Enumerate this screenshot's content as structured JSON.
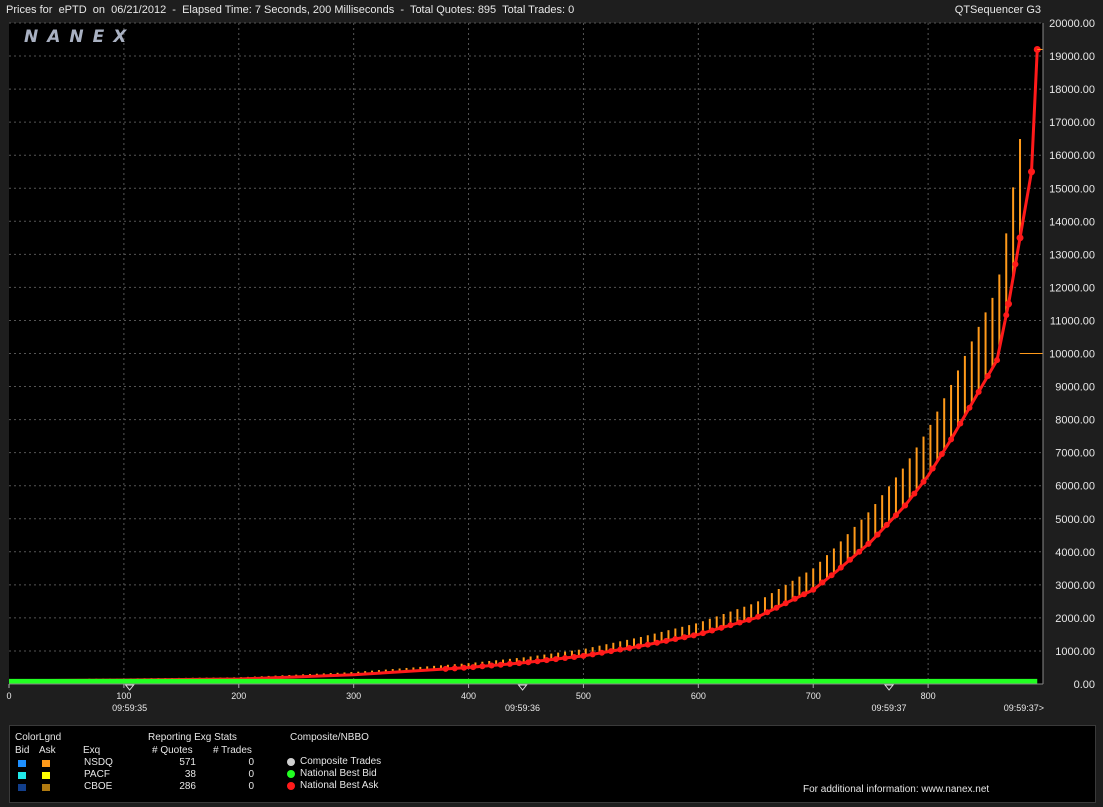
{
  "header": {
    "title": "Prices for  ePTD  on  06/21/2012  -  Elapsed Time: 7 Seconds, 200 Milliseconds  -  Total Quotes: 895  Total Trades: 0",
    "app_name": "QTSequencer G3"
  },
  "watermark": "NANEX",
  "colors": {
    "background": "#000000",
    "grid": "#555555",
    "nsdq_ask": "#ff9a1a",
    "national_best_ask": "#ff1a1a",
    "national_best_bid": "#22ff22",
    "composite_trades": "#d0d0d0"
  },
  "chart_data": {
    "type": "line",
    "title": "",
    "xlabel": "",
    "ylabel": "",
    "xlim": [
      0,
      900
    ],
    "ylim": [
      0,
      20000
    ],
    "grid": true,
    "x_ticks": [
      0,
      100,
      200,
      300,
      400,
      500,
      600,
      700,
      800
    ],
    "y_ticks": [
      "0.00",
      "1000.00",
      "2000.00",
      "3000.00",
      "4000.00",
      "5000.00",
      "6000.00",
      "7000.00",
      "8000.00",
      "9000.00",
      "10000.00",
      "11000.00",
      "12000.00",
      "13000.00",
      "14000.00",
      "15000.00",
      "16000.00",
      "17000.00",
      "18000.00",
      "19000.00",
      "20000.00"
    ],
    "time_labels": [
      {
        "x": 105,
        "label": "09:59:35"
      },
      {
        "x": 447,
        "label": "09:59:36"
      },
      {
        "x": 766,
        "label": "09:59:37"
      },
      {
        "x": 900,
        "label": "09:59:37>"
      }
    ],
    "series": [
      {
        "name": "National Best Ask",
        "color": "#ff1a1a",
        "x": [
          0,
          100,
          200,
          300,
          350,
          400,
          450,
          500,
          550,
          600,
          650,
          700,
          720,
          750,
          780,
          800,
          820,
          840,
          860,
          870,
          880,
          890,
          895
        ],
        "y": [
          100,
          120,
          150,
          280,
          390,
          500,
          650,
          850,
          1150,
          1500,
          2000,
          2850,
          3400,
          4300,
          5400,
          6300,
          7400,
          8600,
          9800,
          11500,
          13500,
          15500,
          19200
        ]
      },
      {
        "name": "National Best Bid",
        "color": "#22ff22",
        "x": [
          0,
          895
        ],
        "y": [
          80,
          80
        ]
      }
    ],
    "reference_lines": [
      {
        "y": 10000,
        "from_x": 880
      },
      {
        "y": 19200,
        "from_x": 895
      }
    ]
  },
  "legend": {
    "colorlgnd": "ColorLgnd",
    "bid": "Bid",
    "ask": "Ask",
    "reporting_title": "Reporting Exg Stats",
    "exq_header": "Exq",
    "quotes_header": "# Quotes",
    "trades_header": "# Trades",
    "rows": [
      {
        "exchange": "NSDQ",
        "quotes": "571",
        "trades": "0",
        "bid_color": "#1e90ff",
        "ask_color": "#ff9a1a"
      },
      {
        "exchange": "PACF",
        "quotes": "38",
        "trades": "0",
        "bid_color": "#20e8e8",
        "ask_color": "#ffff00"
      },
      {
        "exchange": "CBOE",
        "quotes": "286",
        "trades": "0",
        "bid_color": "#123f8c",
        "ask_color": "#b07a10"
      }
    ],
    "composite_title": "Composite/NBBO",
    "composite_items": [
      {
        "label": "Composite Trades",
        "color": "#d0d0d0"
      },
      {
        "label": "National Best Bid",
        "color": "#22ff22"
      },
      {
        "label": "National Best Ask",
        "color": "#ff1a1a"
      }
    ],
    "info": "For additional information: www.nanex.net"
  }
}
